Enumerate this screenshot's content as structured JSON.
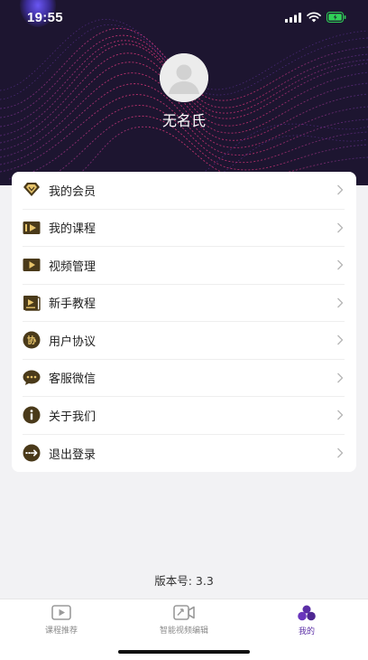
{
  "status_bar": {
    "time": "19:55",
    "icons": [
      "signal-icon",
      "wifi-icon",
      "battery-icon"
    ]
  },
  "profile": {
    "avatar_icon": "user-avatar-icon",
    "name": "无名氏"
  },
  "menu": {
    "items": [
      {
        "label": "我的会员",
        "icon": "vip-diamond-icon"
      },
      {
        "label": "我的课程",
        "icon": "course-play-icon"
      },
      {
        "label": "视频管理",
        "icon": "video-manage-icon"
      },
      {
        "label": "新手教程",
        "icon": "tutorial-icon"
      },
      {
        "label": "用户协议",
        "icon": "agreement-icon"
      },
      {
        "label": "客服微信",
        "icon": "chat-bubble-icon"
      },
      {
        "label": "关于我们",
        "icon": "info-icon"
      },
      {
        "label": "退出登录",
        "icon": "logout-icon"
      }
    ]
  },
  "version": "版本号: 3.3",
  "tabbar": {
    "tabs": [
      {
        "label": "课程推荐",
        "icon": "course-recommend-icon",
        "active": false
      },
      {
        "label": "智能视频编辑",
        "icon": "video-edit-icon",
        "active": false
      },
      {
        "label": "我的",
        "icon": "profile-tab-icon",
        "active": true
      }
    ]
  },
  "colors": {
    "header_bg": "#1d1530",
    "icon_gold": "#e6c36a",
    "active_tab": "#5b2ea6",
    "page_bg": "#f2f2f4"
  }
}
